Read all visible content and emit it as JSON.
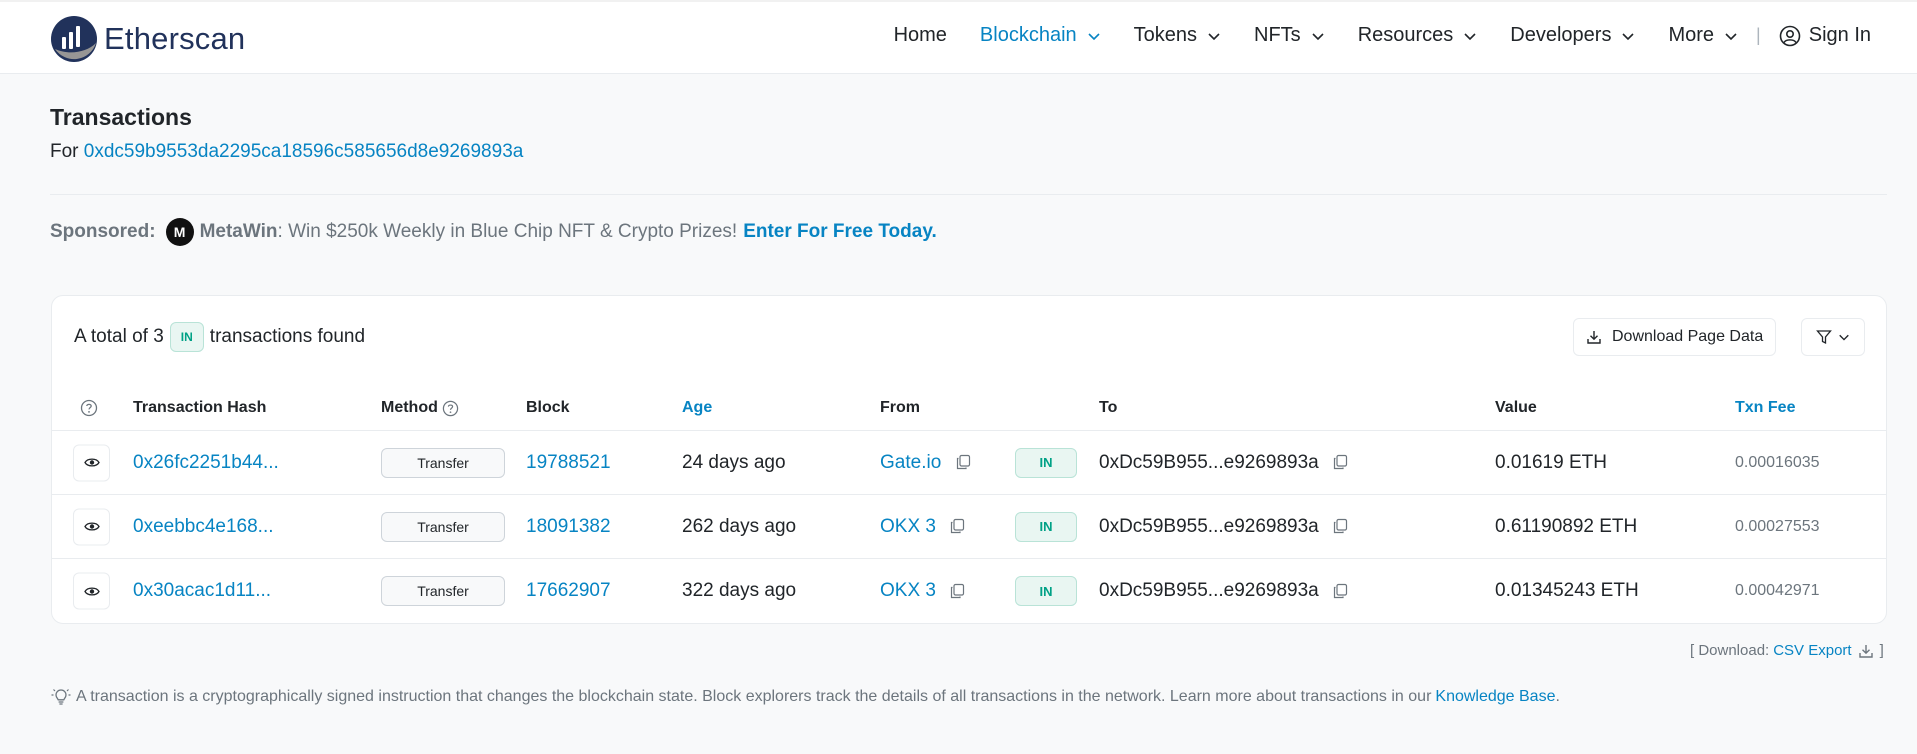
{
  "header": {
    "logo_text": "Etherscan",
    "nav": [
      {
        "label": "Home",
        "dropdown": false,
        "active": false
      },
      {
        "label": "Blockchain",
        "dropdown": true,
        "active": true
      },
      {
        "label": "Tokens",
        "dropdown": true,
        "active": false
      },
      {
        "label": "NFTs",
        "dropdown": true,
        "active": false
      },
      {
        "label": "Resources",
        "dropdown": true,
        "active": false
      },
      {
        "label": "Developers",
        "dropdown": true,
        "active": false
      },
      {
        "label": "More",
        "dropdown": true,
        "active": false
      }
    ],
    "separator": "|",
    "sign_in": "Sign In"
  },
  "page": {
    "title": "Transactions",
    "for_label": "For",
    "address": "0xdc59b9553da2295ca18596c585656d8e9269893a"
  },
  "sponsored": {
    "label": "Sponsored:",
    "brand": "MetaWin",
    "text": ": Win $250k Weekly in Blue Chip NFT & Crypto Prizes!",
    "cta": "Enter For Free Today."
  },
  "summary": {
    "prefix": "A total of 3",
    "badge": "IN",
    "suffix": "transactions found",
    "download_button": "Download Page Data"
  },
  "table": {
    "columns": {
      "hash": "Transaction Hash",
      "method": "Method",
      "block": "Block",
      "age": "Age",
      "from": "From",
      "to": "To",
      "value": "Value",
      "fee": "Txn Fee"
    },
    "rows": [
      {
        "hash": "0x26fc2251b44...",
        "method": "Transfer",
        "block": "19788521",
        "age": "24 days ago",
        "from": "Gate.io",
        "direction": "IN",
        "to": "0xDc59B955...e9269893a",
        "value": "0.01619 ETH",
        "fee": "0.00016035"
      },
      {
        "hash": "0xeebbc4e168...",
        "method": "Transfer",
        "block": "18091382",
        "age": "262 days ago",
        "from": "OKX 3",
        "direction": "IN",
        "to": "0xDc59B955...e9269893a",
        "value": "0.61190892 ETH",
        "fee": "0.00027553"
      },
      {
        "hash": "0x30acac1d11...",
        "method": "Transfer",
        "block": "17662907",
        "age": "322 days ago",
        "from": "OKX 3",
        "direction": "IN",
        "to": "0xDc59B955...e9269893a",
        "value": "0.01345243 ETH",
        "fee": "0.00042971"
      }
    ]
  },
  "csv": {
    "prefix": "[ Download:",
    "link": "CSV Export",
    "suffix": "]"
  },
  "footnote": {
    "text": "A transaction is a cryptographically signed instruction that changes the blockchain state. Block explorers track the details of all transactions in the network. Learn more about transactions in our",
    "link": "Knowledge Base",
    "end": "."
  },
  "colors": {
    "link": "#0784c3",
    "in_badge": "#00a186",
    "logo_navy": "#21325b"
  }
}
